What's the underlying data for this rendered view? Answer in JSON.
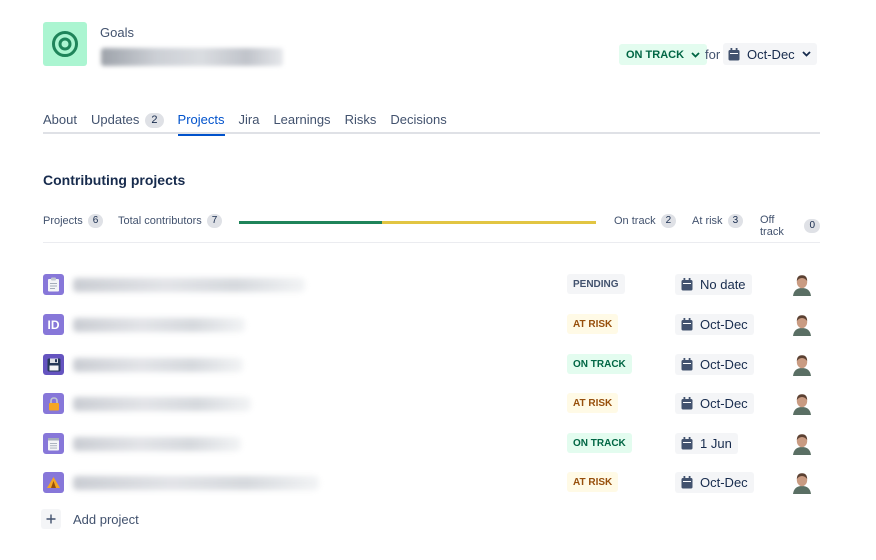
{
  "header": {
    "breadcrumb": "Goals",
    "goal_icon": "target-icon",
    "status": "ON TRACK",
    "for_label": "for",
    "period": "Oct-Dec"
  },
  "tabs": [
    {
      "label": "About"
    },
    {
      "label": "Updates",
      "count": "2"
    },
    {
      "label": "Projects",
      "active": true
    },
    {
      "label": "Jira"
    },
    {
      "label": "Learnings"
    },
    {
      "label": "Risks"
    },
    {
      "label": "Decisions"
    }
  ],
  "section": {
    "title": "Contributing projects"
  },
  "stats": {
    "projects_label": "Projects",
    "projects_count": "6",
    "contributors_label": "Total contributors",
    "contributors_count": "7",
    "on_track_label": "On track",
    "on_track_count": "2",
    "at_risk_label": "At risk",
    "at_risk_count": "3",
    "off_track_label": "Off track",
    "off_track_count": "0",
    "colors": {
      "on_track": "#1f845a",
      "at_risk": "#e2c542",
      "off_track": "#de350b"
    }
  },
  "projects": [
    {
      "icon": "clipboard-icon",
      "status": "PENDING",
      "status_kind": "pending",
      "date": "No date"
    },
    {
      "icon": "id-card-icon",
      "status": "AT RISK",
      "status_kind": "atrisk",
      "date": "Oct-Dec"
    },
    {
      "icon": "floppy-disk-icon",
      "status": "ON TRACK",
      "status_kind": "ontrack",
      "date": "Oct-Dec"
    },
    {
      "icon": "lock-icon",
      "status": "AT RISK",
      "status_kind": "atrisk",
      "date": "Oct-Dec"
    },
    {
      "icon": "notepad-icon",
      "status": "ON TRACK",
      "status_kind": "ontrack",
      "date": "1 Jun"
    },
    {
      "icon": "tent-icon",
      "status": "AT RISK",
      "status_kind": "atrisk",
      "date": "Oct-Dec"
    }
  ],
  "add_project_label": "Add project"
}
